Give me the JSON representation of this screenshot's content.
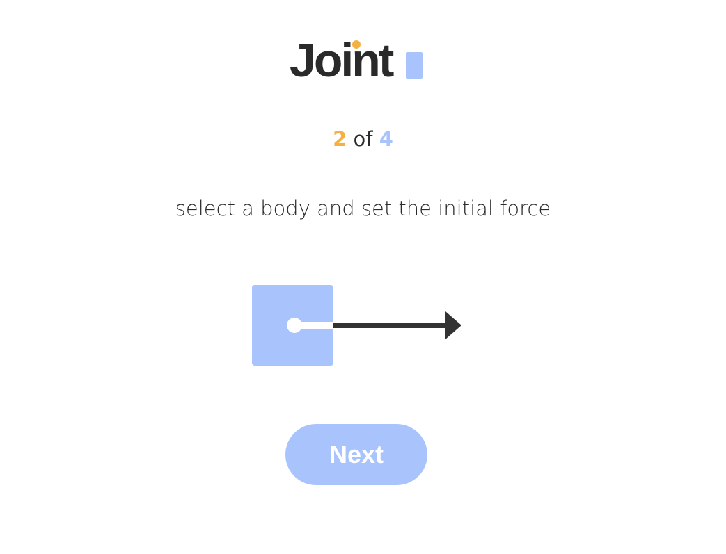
{
  "app": {
    "logo_text": "Joint"
  },
  "colors": {
    "accent_orange": "#F5B041",
    "accent_blue": "#A9C4FC",
    "text_dark": "#2B2B2B",
    "arrow_dark": "#333333"
  },
  "progress": {
    "current": "2",
    "separator": "of",
    "total": "4"
  },
  "instruction": {
    "text": "select a body and set the initial force"
  },
  "illustration": {
    "icon": "body-with-force-arrow-icon"
  },
  "actions": {
    "next_label": "Next"
  }
}
